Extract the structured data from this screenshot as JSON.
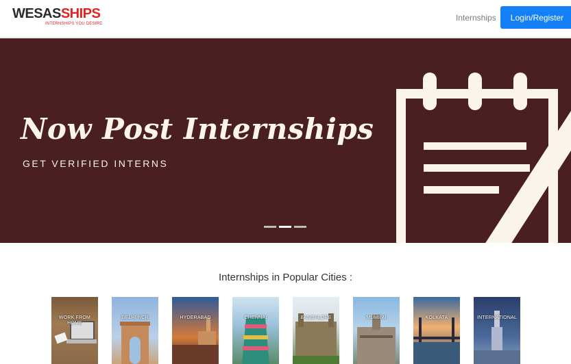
{
  "header": {
    "logo": {
      "part1": "WESAS",
      "part2": "SHIPS",
      "tagline": "INTERNSHIPS YOU DESIRE"
    },
    "nav_internships": "Internships",
    "login_label": "Login/Register",
    "colors": {
      "accent": "#1580f5",
      "brand_red": "#e32222"
    }
  },
  "hero": {
    "title": "Now Post Internships",
    "subtitle": "GET VERIFIED INTERNS",
    "background": "#4a1f22",
    "slides_total": 3,
    "active_slide": 2
  },
  "cities": {
    "heading": "Internships in Popular Cities :",
    "items": [
      {
        "label": "WORK FROM HOME",
        "icon": "laptop-image"
      },
      {
        "label": "DELHI NCR",
        "icon": "india-gate-image"
      },
      {
        "label": "HYDERABAD",
        "icon": "charminar-image"
      },
      {
        "label": "CHENNAI",
        "icon": "temple-image"
      },
      {
        "label": "BANGALORE",
        "icon": "palace-image"
      },
      {
        "label": "MUMBAI",
        "icon": "cst-station-image"
      },
      {
        "label": "KOLKATA",
        "icon": "howrah-bridge-image"
      },
      {
        "label": "INTERNATIONAL",
        "icon": "empire-state-image"
      }
    ]
  }
}
